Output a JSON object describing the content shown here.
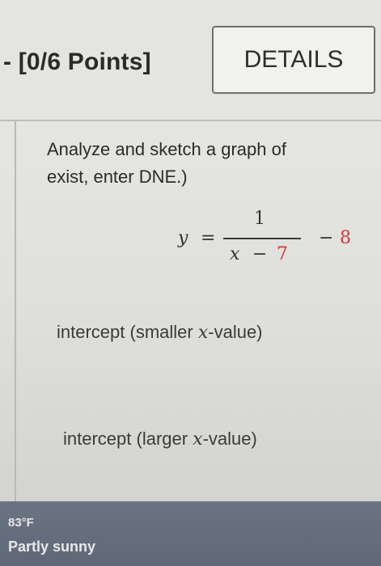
{
  "header": {
    "points_label": "- [0/6 Points]",
    "details_button": "DETAILS"
  },
  "question": {
    "line1": "Analyze and sketch a graph of",
    "line2": "exist, enter DNE.)"
  },
  "equation": {
    "lhs": "y",
    "equals": "=",
    "numerator": "1",
    "den_var": "x",
    "den_op": "−",
    "den_const": "7",
    "tail_op": "−",
    "tail_const": "8"
  },
  "fields": {
    "intercept1_prefix": "intercept (smaller ",
    "intercept1_var": "x",
    "intercept1_suffix": "-value)",
    "intercept2_prefix": "intercept (larger ",
    "intercept2_var": "x",
    "intercept2_suffix": "-value)"
  },
  "taskbar": {
    "temperature": "83°F",
    "weather": "Partly sunny"
  },
  "colors": {
    "highlight_red": "#d23a3a"
  }
}
